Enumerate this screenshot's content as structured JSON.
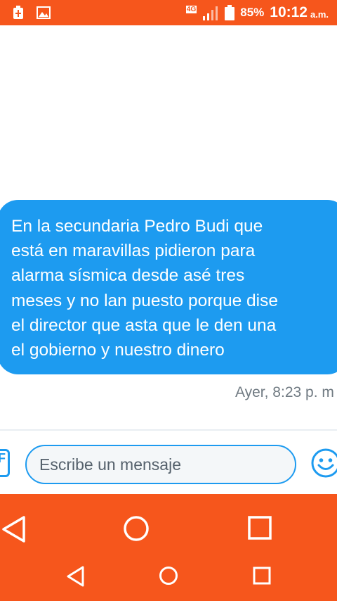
{
  "status_bar": {
    "network": "4G",
    "battery": "85%",
    "time": "10:12",
    "ampm": "a.m."
  },
  "message": {
    "text": "En la secundaria Pedro Budi que\nestá en maravillas pidieron para\nalarma sísmica desde asé tres\nmeses y no lan puesto porque dise\nel director que asta que le den una\nel gobierno y nuestro dinero",
    "timestamp": "Ayer, 8:23 p. m"
  },
  "composer": {
    "placeholder": "Escribe un mensaje",
    "value": ""
  },
  "colors": {
    "accent": "#1d9bf0",
    "system_bar": "#f6561c"
  }
}
